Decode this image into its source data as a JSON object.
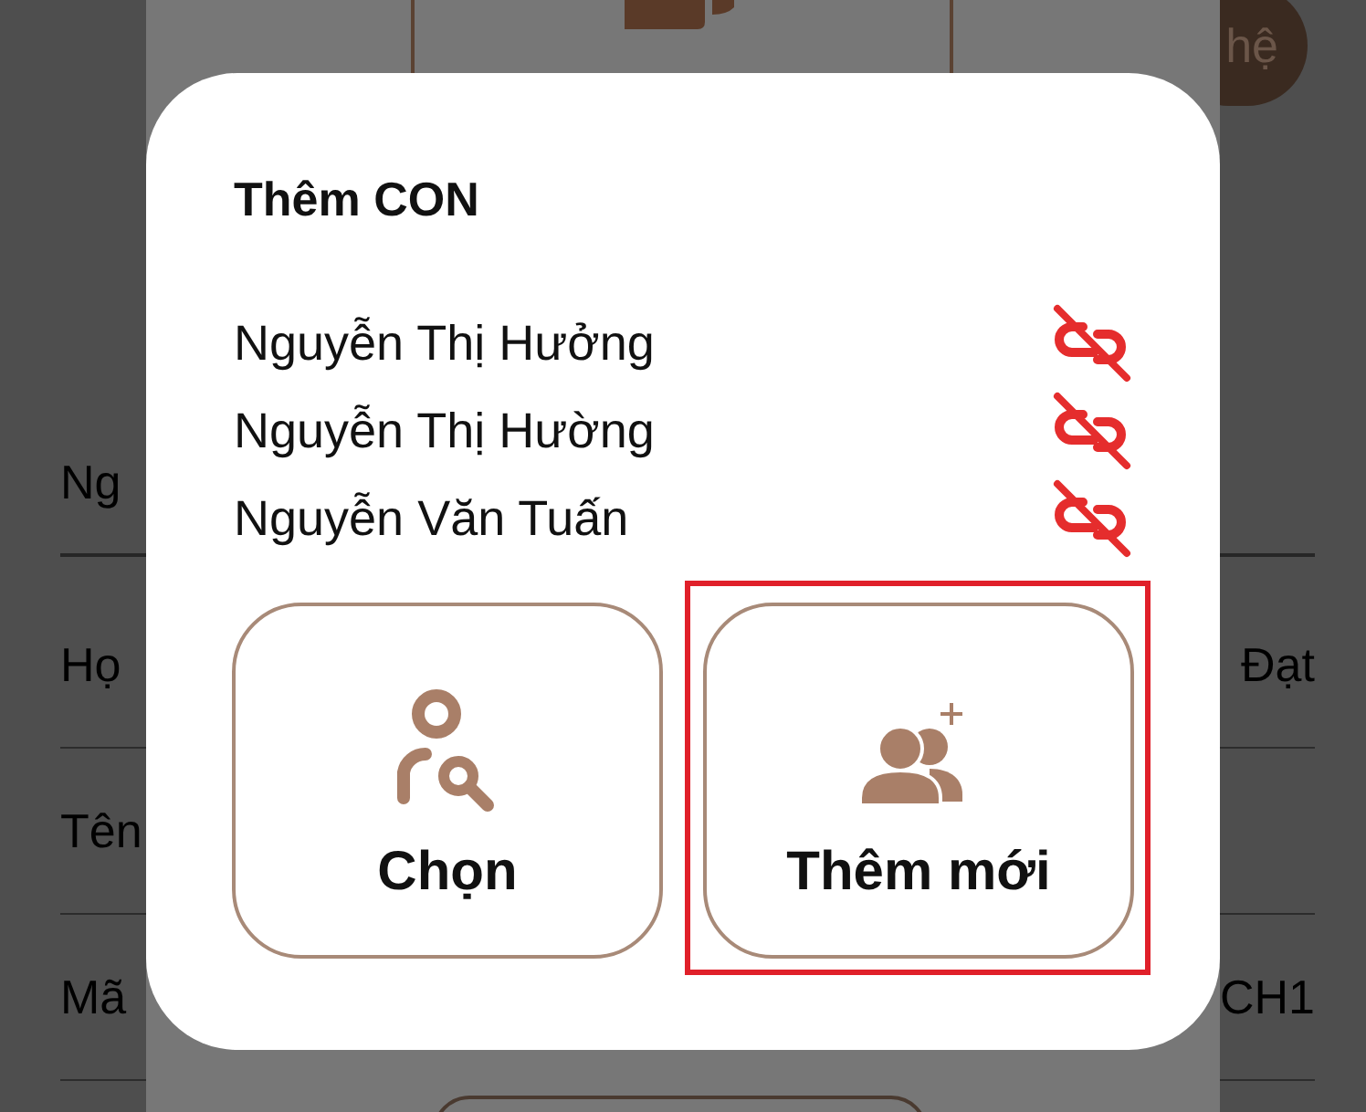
{
  "background_page": {
    "contact_button": {
      "label": "hệ"
    },
    "rows": [
      {
        "label": "Ng"
      },
      {
        "label": "Họ",
        "value": "Đạt"
      },
      {
        "label": "Tên"
      },
      {
        "label": "Mã",
        "value": "CH1"
      }
    ]
  },
  "dialog": {
    "title": "Thêm CON",
    "members": [
      {
        "name": "Nguyễn Thị Hưởng"
      },
      {
        "name": "Nguyễn Thị Hường"
      },
      {
        "name": "Nguyễn Văn Tuấn"
      }
    ],
    "options": [
      {
        "kind": "choose",
        "label": "Chọn",
        "highlighted": false
      },
      {
        "kind": "add",
        "label": "Thêm mới",
        "highlighted": true
      }
    ]
  }
}
